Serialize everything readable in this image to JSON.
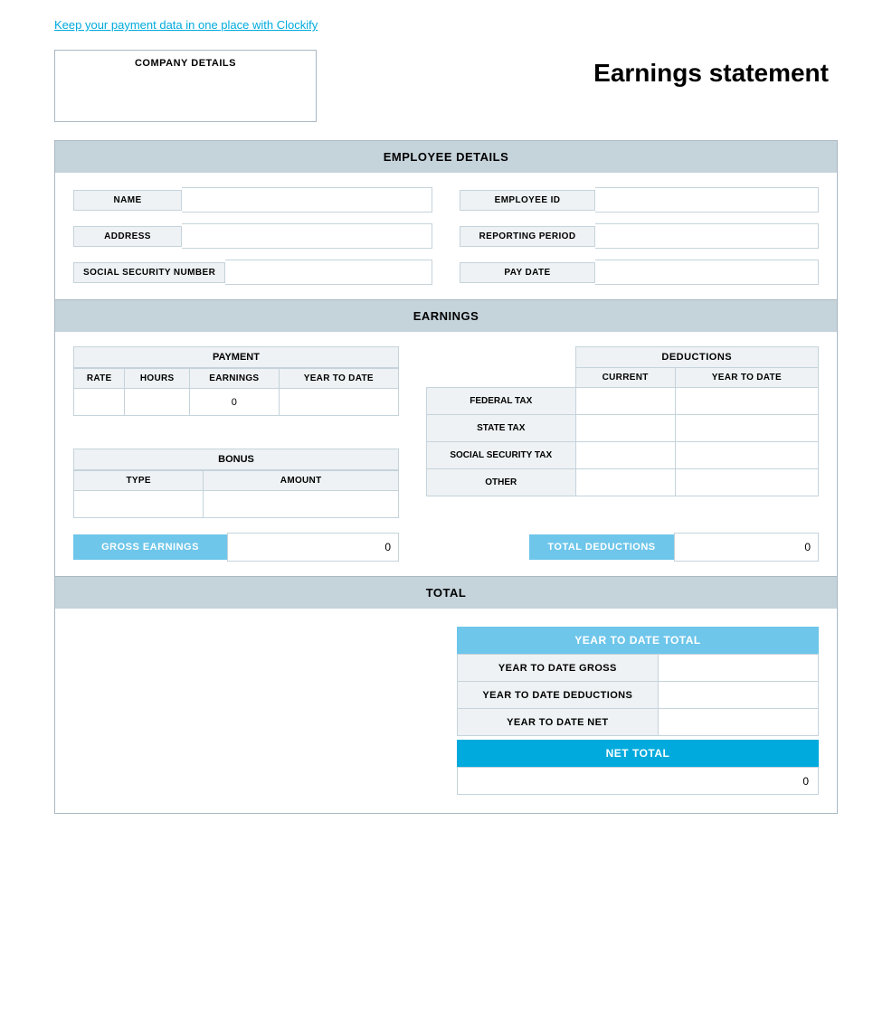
{
  "topLink": {
    "text": "Keep your payment data in one place with Clockify",
    "href": "#"
  },
  "companyDetails": {
    "label": "COMPANY DETAILS"
  },
  "earningsTitle": "Earnings statement",
  "employeeDetails": {
    "sectionHeader": "EMPLOYEE DETAILS",
    "fields": {
      "name": {
        "label": "NAME",
        "value": ""
      },
      "employeeId": {
        "label": "EMPLOYEE ID",
        "value": ""
      },
      "address": {
        "label": "ADDRESS",
        "value": ""
      },
      "reportingPeriod": {
        "label": "REPORTING PERIOD",
        "value": ""
      },
      "socialSecurityNumber": {
        "label": "SOCIAL SECURITY NUMBER",
        "value": ""
      },
      "payDate": {
        "label": "PAY DATE",
        "value": ""
      }
    }
  },
  "earnings": {
    "sectionHeader": "EARNINGS",
    "payment": {
      "tableHeader": "PAYMENT",
      "columns": [
        "RATE",
        "HOURS",
        "EARNINGS",
        "YEAR TO DATE"
      ],
      "rows": [
        {
          "rate": "",
          "hours": "",
          "earnings": "0",
          "yearToDate": ""
        }
      ]
    },
    "bonus": {
      "tableHeader": "BONUS",
      "columns": [
        "TYPE",
        "AMOUNT"
      ],
      "rows": [
        {
          "type": "",
          "amount": ""
        }
      ]
    },
    "deductions": {
      "tableHeader": "DEDUCTIONS",
      "columns": [
        "CURRENT",
        "YEAR TO DATE"
      ],
      "rows": [
        {
          "label": "FEDERAL TAX",
          "current": "",
          "yearToDate": ""
        },
        {
          "label": "STATE TAX",
          "current": "",
          "yearToDate": ""
        },
        {
          "label": "SOCIAL SECURITY TAX",
          "current": "",
          "yearToDate": ""
        },
        {
          "label": "OTHER",
          "current": "",
          "yearToDate": ""
        }
      ]
    },
    "grossEarnings": {
      "label": "GROSS EARNINGS",
      "value": "0"
    },
    "totalDeductions": {
      "label": "TOTAL DEDUCTIONS",
      "value": "0"
    }
  },
  "total": {
    "sectionHeader": "TOTAL",
    "ytdTotal": {
      "header": "YEAR TO DATE TOTAL",
      "rows": [
        {
          "label": "YEAR TO DATE GROSS",
          "value": ""
        },
        {
          "label": "YEAR TO DATE DEDUCTIONS",
          "value": ""
        },
        {
          "label": "YEAR TO DATE NET",
          "value": ""
        }
      ]
    },
    "netTotal": {
      "header": "NET TOTAL",
      "value": "0"
    }
  }
}
